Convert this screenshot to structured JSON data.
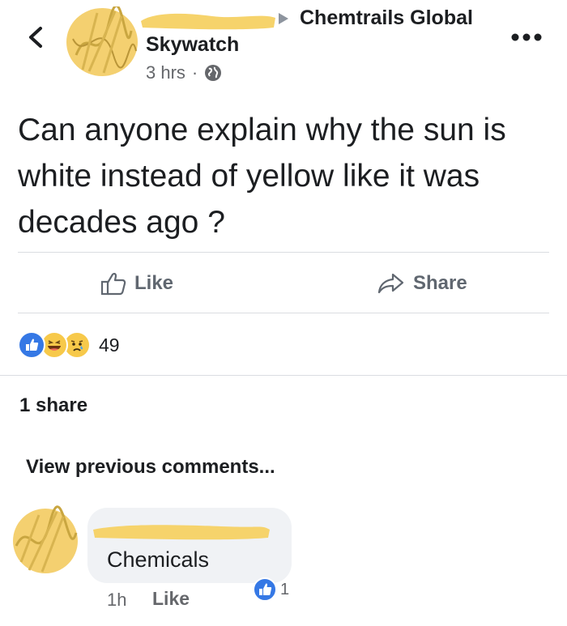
{
  "header": {
    "group_name": "Chemtrails Global",
    "page_name": "Skywatch",
    "timestamp": "3 hrs",
    "separator": "·",
    "icons": {
      "back": "chevron-left-icon",
      "arrow": "triangle-right-icon",
      "privacy": "globe-icon",
      "more": "more-dots-icon"
    }
  },
  "post": {
    "text": "Can anyone explain why the sun is white instead of yellow like it was decades ago ?"
  },
  "actions": {
    "like_label": "Like",
    "share_label": "Share"
  },
  "reactions": {
    "types": [
      "like",
      "haha",
      "sad"
    ],
    "count": "49"
  },
  "shares": {
    "label": "1 share"
  },
  "comments": {
    "view_previous": "View previous comments...",
    "items": [
      {
        "text": "Chemicals",
        "time": "1h",
        "like_label": "Like",
        "reaction_count": "1"
      }
    ]
  },
  "colors": {
    "redaction": "#f6d36b",
    "like_blue": "#3578e5",
    "text": "#1c1e21",
    "secondary": "#65676b",
    "divider": "#dadde1",
    "bubble": "#f0f2f5"
  }
}
